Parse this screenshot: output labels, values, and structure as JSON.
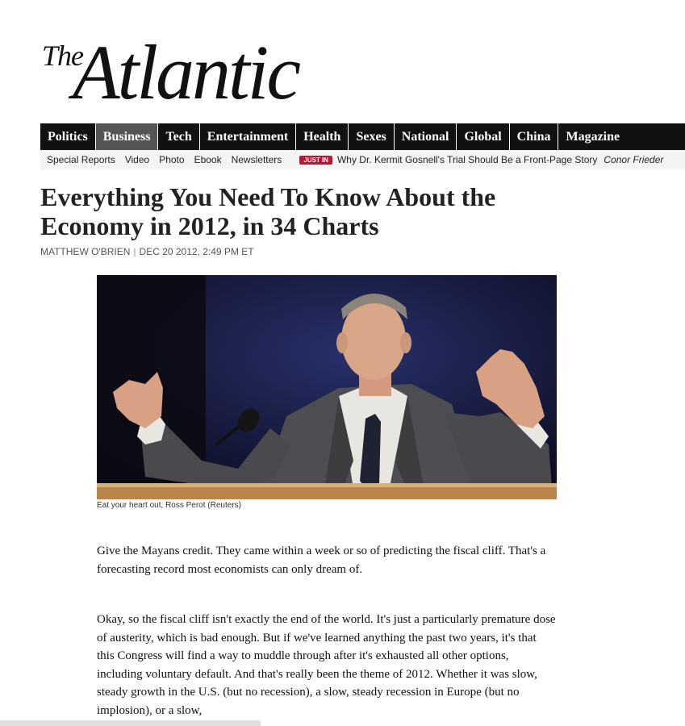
{
  "logo": {
    "the": "The",
    "name": "Atlantic"
  },
  "nav": {
    "items": [
      "Politics",
      "Business",
      "Tech",
      "Entertainment",
      "Health",
      "Sexes",
      "National",
      "Global",
      "China",
      "Magazine"
    ],
    "active": "Business"
  },
  "subnav": {
    "links": [
      "Special Reports",
      "Video",
      "Photo",
      "Ebook",
      "Newsletters"
    ],
    "badge": "JUST IN",
    "story": "Why Dr. Kermit Gosnell's Trial Should Be a Front-Page Story",
    "author": "Conor Frieder"
  },
  "article": {
    "headline": "Everything You Need To Know About the Economy in 2012, in 34 Charts",
    "author": "MATTHEW O'BRIEN",
    "date": "DEC 20 2012, 2:49 PM ET",
    "caption": "Eat your heart out, Ross Perot (Reuters)",
    "paragraphs": [
      "Give the Mayans credit. They came within a week or so of predicting the fiscal cliff. That's a forecasting record most economists can only dream of.",
      "Okay, so the fiscal cliff isn't exactly the end of the world. It's just a particularly premature dose of austerity, which is bad enough. But if we've learned anything the past two years, it's that this Congress will find a way to muddle through after it's exhausted all other options, including voluntary default. And that's really been the theme of 2012. Whether it was slow, steady growth in the U.S. (but no recession), a slow, steady recession in Europe (but no implosion), or a slow,"
    ]
  }
}
